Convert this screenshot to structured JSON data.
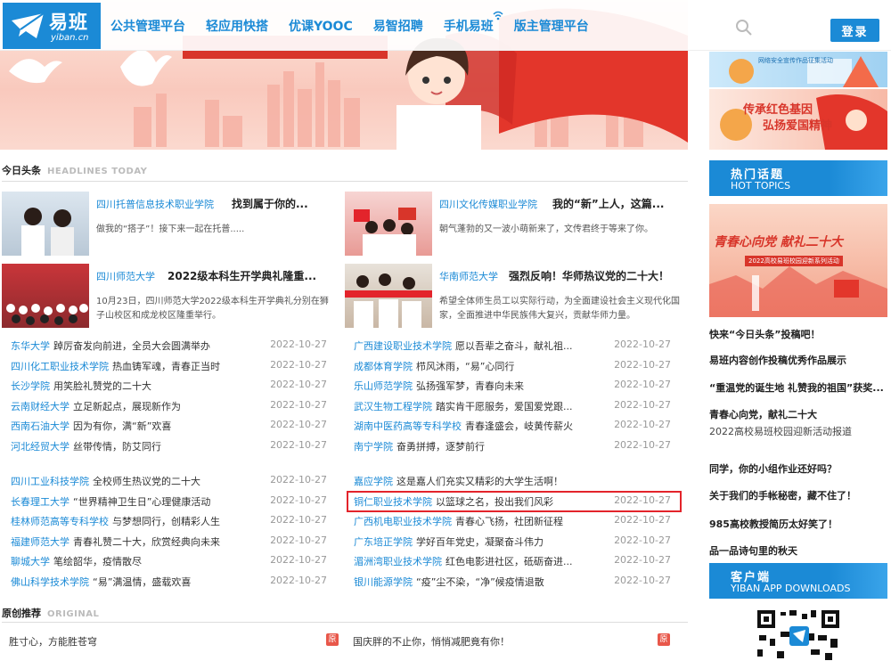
{
  "header": {
    "logo_name": "易班",
    "logo_url": "yiban.cn",
    "nav": [
      "公共管理平台",
      "轻应用快搭",
      "优课YOOC",
      "易智招聘",
      "手机易班",
      "版主管理平台"
    ],
    "login_label": "登录"
  },
  "right": {
    "ad1_text": "网络安全宣传作品征集活动",
    "ad2_line1": "传承红色基因",
    "ad2_line2": "弘扬爱国精神",
    "hot_title": "热门话题",
    "hot_subtitle": "HOT TOPICS",
    "hot_banner_title": "青春心向党 献礼二十大",
    "hot_banner_sub": "2022高校易班校园迎新系列活动",
    "topics": [
      {
        "text": "快来“今日头条”投稿吧！",
        "sub": false
      },
      {
        "text": "易班内容创作投稿优秀作品展示",
        "sub": false
      },
      {
        "text": "“重温党的诞生地 礼赞我的祖国”获奖...",
        "sub": false
      },
      {
        "text": "青春心向党，献礼二十大",
        "sub": false
      },
      {
        "text": "2022高校易班校园迎新活动报道",
        "sub": true
      },
      {
        "text": "同学，你的小组作业还好吗？",
        "sub": false
      },
      {
        "text": "关于我们的手帐秘密，藏不住了！",
        "sub": false
      },
      {
        "text": "985高校教授简历太好笑了！",
        "sub": false
      },
      {
        "text": "品一品诗句里的秋天",
        "sub": false
      }
    ],
    "app_title": "客户端",
    "app_subtitle": "YIBAN APP DOWNLOADS"
  },
  "headlines": {
    "title": "今日头条",
    "title_en": "HEADLINES TODAY"
  },
  "featured": [
    {
      "school": "四川托普信息技术职业学院",
      "title": "找到属于你的...",
      "desc": "做我的“搭子”！接下来一起在托普....."
    },
    {
      "school": "四川文化传媒职业学院",
      "title": "我的“新”上人，这篇...",
      "desc": "朝气蓬勃的又一波小萌新来了，文传君终于等来了你。"
    },
    {
      "school": "四川师范大学",
      "title": "2022级本科生开学典礼隆重...",
      "desc": "10月23日，四川师范大学2022级本科生开学典礼分别在狮子山校区和成龙校区隆重举行。"
    },
    {
      "school": "华南师范大学",
      "title": "强烈反响！华师热议党的二十大！",
      "desc": "希望全体师生员工以实际行动，为全面建设社会主义现代化国家，全面推进中华民族伟大复兴，贡献华师力量。"
    }
  ],
  "news_left_1": [
    {
      "school": "东华大学",
      "text": "踔厉奋发向前进，全员大会圆满举办",
      "date": "2022-10-27"
    },
    {
      "school": "四川化工职业技术学院",
      "text": "热血铸军魂，青春正当时",
      "date": "2022-10-27"
    },
    {
      "school": "长沙学院",
      "text": "用笑脸礼赞党的二十大",
      "date": "2022-10-27"
    },
    {
      "school": "云南财经大学",
      "text": "立足新起点，展现新作为",
      "date": "2022-10-27"
    },
    {
      "school": "西南石油大学",
      "text": "因为有你，满“新”欢喜",
      "date": "2022-10-27"
    },
    {
      "school": "河北经贸大学",
      "text": "丝带传情，防艾同行",
      "date": "2022-10-27"
    }
  ],
  "news_right_1": [
    {
      "school": "广西建设职业技术学院",
      "text": "愿以吾辈之奋斗，献礼祖...",
      "date": "2022-10-27"
    },
    {
      "school": "成都体育学院",
      "text": "栉风沐雨，“易”心同行",
      "date": "2022-10-27"
    },
    {
      "school": "乐山师范学院",
      "text": "弘扬强军梦，青春向未来",
      "date": "2022-10-27"
    },
    {
      "school": "武汉生物工程学院",
      "text": "踏实肯干愿服务，爱国爱党跟...",
      "date": "2022-10-27"
    },
    {
      "school": "湖南中医药高等专科学校",
      "text": "青春逢盛会，岐黄传薪火",
      "date": "2022-10-27"
    },
    {
      "school": "南宁学院",
      "text": "奋勇拼搏，逐梦前行",
      "date": "2022-10-27"
    }
  ],
  "news_left_2": [
    {
      "school": "四川工业科技学院",
      "text": "全校师生热议党的二十大",
      "date": "2022-10-27"
    },
    {
      "school": "长春理工大学",
      "text": "“世界精神卫生日”心理健康活动",
      "date": "2022-10-27"
    },
    {
      "school": "桂林师范高等专科学校",
      "text": "与梦想同行，创精彩人生",
      "date": "2022-10-27"
    },
    {
      "school": "福建师范大学",
      "text": "青春礼赞二十大，欣赏经典向未来",
      "date": "2022-10-27"
    },
    {
      "school": "聊城大学",
      "text": "笔绘韶华，疫情散尽",
      "date": "2022-10-27"
    },
    {
      "school": "佛山科学技术学院",
      "text": "“易”满温情，盛载欢喜",
      "date": "2022-10-27"
    }
  ],
  "news_right_2": [
    {
      "school": "嘉应学院",
      "text": "这是嘉人们充实又精彩的大学生活啊！",
      "date": ""
    },
    {
      "school": "铜仁职业技术学院",
      "text": "以篮球之名，投出我们风彩",
      "date": "2022-10-27"
    },
    {
      "school": "广西机电职业技术学院",
      "text": "青春心飞扬，社团新征程",
      "date": "2022-10-27"
    },
    {
      "school": "广东培正学院",
      "text": "学好百年党史，凝聚奋斗伟力",
      "date": "2022-10-27"
    },
    {
      "school": "湄洲湾职业技术学院",
      "text": "红色电影进社区，砥砺奋进...",
      "date": "2022-10-27"
    },
    {
      "school": "银川能源学院",
      "text": "“疫”尘不染，“净”候疫情退散",
      "date": "2022-10-27"
    }
  ],
  "originals": {
    "title": "原创推荐",
    "title_en": "ORIGINAL",
    "badge": "原",
    "items": [
      "胜寸心，方能胜苍穹",
      "国庆胖的不止你，悄悄减肥竟有你！"
    ]
  },
  "colors": {
    "brand": "#1b8ad6",
    "highlight": "#e3242b"
  }
}
